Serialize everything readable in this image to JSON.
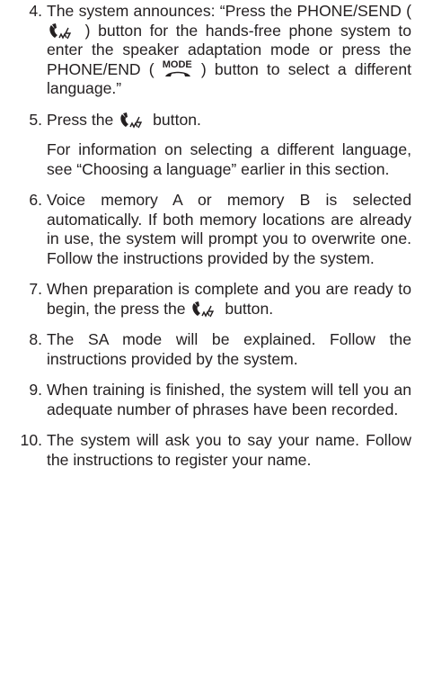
{
  "icons": {
    "phone_send": "phone-send-icon",
    "phone_end": "phone-end-mode-icon"
  },
  "mode_label": "MODE",
  "steps": [
    {
      "num": "4.",
      "a": "The system announces: “Press the PHONE/SEND (",
      "b": ") button for the hands-free phone system to enter the speaker adaptation mode or press the PHONE/END (",
      "c": ") button to select a different language.”"
    },
    {
      "num": "5.",
      "a": "Press the",
      "b": "button.",
      "sub": "For information on selecting a different language, see “Choosing a language” earlier in this section."
    },
    {
      "num": "6.",
      "a": "Voice memory A or memory B is selected automatically. If both memory locations are already in use, the system will prompt you to overwrite one. Follow the instructions provided by the system."
    },
    {
      "num": "7.",
      "a": "When preparation is complete and you are ready to begin, the press the",
      "b": "button."
    },
    {
      "num": "8.",
      "a": "The SA mode will be explained. Follow the instructions provided by the system."
    },
    {
      "num": "9.",
      "a": "When training is finished, the system will tell you an adequate number of phrases have been recorded."
    },
    {
      "num": "10.",
      "a": "The system will ask you to say your name. Follow the instructions to register your name."
    }
  ]
}
